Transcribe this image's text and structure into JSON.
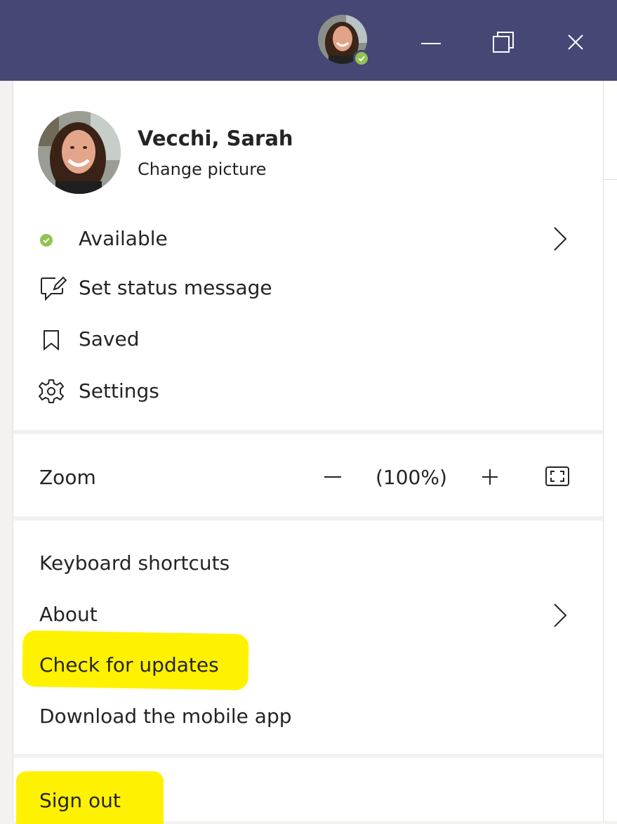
{
  "window": {
    "title_avatar_alt": "Profile picture",
    "buttons": {
      "minimize": "minimize",
      "maximize": "maximize",
      "close": "close"
    }
  },
  "profile": {
    "name": "Vecchi, Sarah",
    "change_picture": "Change picture"
  },
  "menu": {
    "available": "Available",
    "set_status": "Set status message",
    "saved": "Saved",
    "settings": "Settings",
    "zoom": "Zoom",
    "zoom_value": "(100%)",
    "keyboard_shortcuts": "Keyboard shortcuts",
    "about": "About",
    "check_updates": "Check for updates",
    "download_mobile": "Download the mobile app",
    "sign_out": "Sign out"
  },
  "colors": {
    "titlebar": "#464775",
    "presence_available": "#92c353",
    "highlight": "#fff200"
  },
  "icons": {
    "status": "available-dot-icon",
    "set_status": "edit-message-icon",
    "saved": "bookmark-icon",
    "settings": "gear-icon",
    "zoom_out": "minus-icon",
    "zoom_in": "plus-icon",
    "fullscreen": "fullscreen-icon"
  }
}
